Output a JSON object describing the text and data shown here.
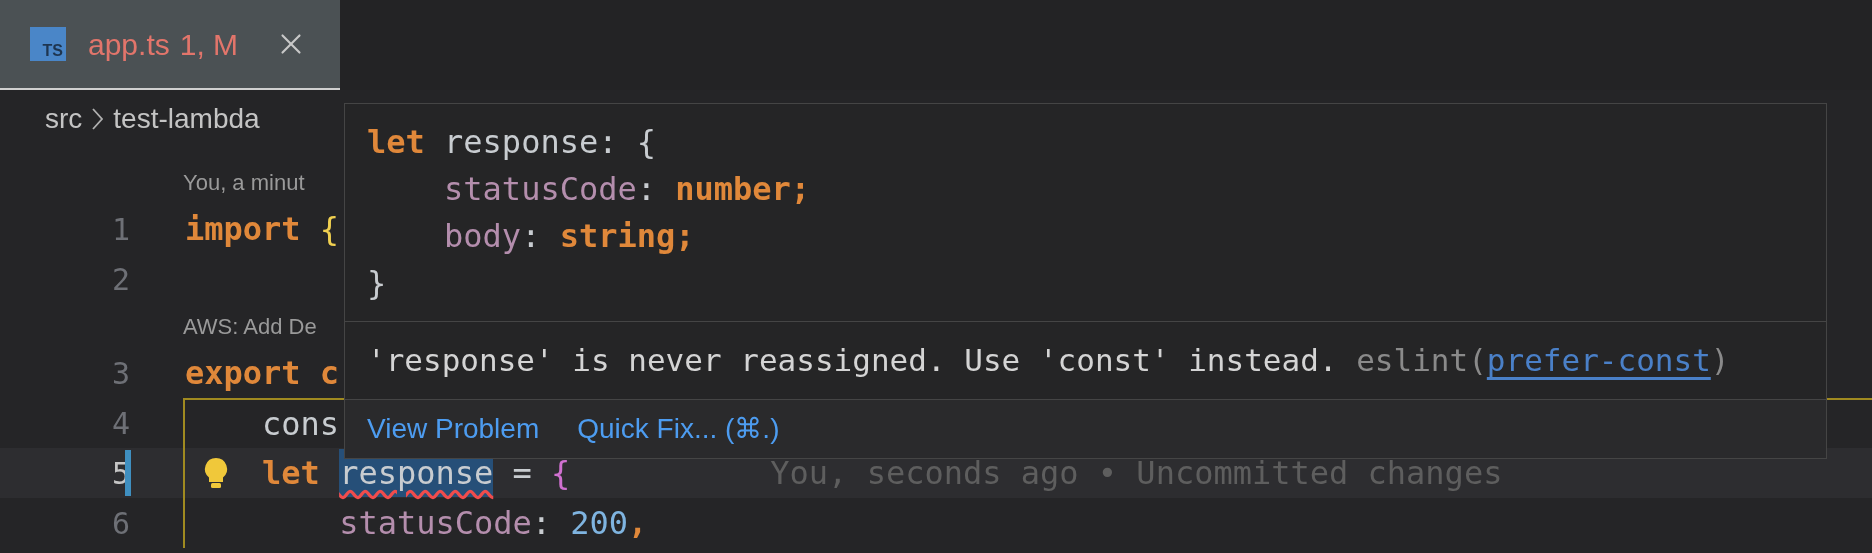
{
  "tab": {
    "icon": "TS",
    "label": "app.ts",
    "badge": "1, M"
  },
  "breadcrumb": [
    "src",
    "test-lambda"
  ],
  "editor": {
    "lines": [
      {
        "kind": "codelens",
        "text": "You, a minut"
      },
      {
        "kind": "code",
        "number": "1",
        "modified": false,
        "lightbulb": false,
        "current": false,
        "bracket_scope": false,
        "tokens": [
          {
            "text": "import",
            "kind": "keyword"
          },
          {
            "text": " {",
            "kind": "brace"
          }
        ]
      },
      {
        "kind": "code",
        "number": "2",
        "modified": false,
        "lightbulb": false,
        "current": false,
        "bracket_scope": false
      },
      {
        "kind": "codelens",
        "text": "AWS: Add De"
      },
      {
        "kind": "code",
        "number": "3",
        "modified": false,
        "lightbulb": false,
        "current": false,
        "bracket_scope": false,
        "tokens": [
          {
            "text": "export c",
            "kind": "keyword"
          }
        ]
      },
      {
        "kind": "code",
        "number": "4",
        "modified": false,
        "lightbulb": false,
        "current": false,
        "bracket_scope": true,
        "tokens": [
          {
            "text": "    cons",
            "kind": "plain"
          }
        ]
      },
      {
        "kind": "code",
        "number": "5",
        "modified": true,
        "lightbulb": true,
        "current": true,
        "bracket_scope": true,
        "tokens": [
          {
            "text": "let ",
            "kind": "keyword"
          },
          {
            "text": "response",
            "kind": "error"
          },
          {
            "text": " = ",
            "kind": "plain"
          },
          {
            "text": "{",
            "kind": "brace2"
          }
        ],
        "blame": "You, seconds ago • Uncommitted changes"
      },
      {
        "kind": "code",
        "number": "6",
        "modified": false,
        "lightbulb": false,
        "current": false,
        "bracket_scope": true,
        "tokens": [
          {
            "text": "        statusCode",
            "kind": "property"
          },
          {
            "text": ": ",
            "kind": "plain"
          },
          {
            "text": "200",
            "kind": "number"
          },
          {
            "text": ",",
            "kind": "keyword"
          }
        ]
      }
    ]
  },
  "hover": {
    "code": [
      [
        {
          "text": "let",
          "kind": "keyword"
        },
        {
          "text": " response: {",
          "kind": "plain"
        }
      ],
      [
        {
          "text": "    statusCode",
          "kind": "property"
        },
        {
          "text": ": ",
          "kind": "plain"
        },
        {
          "text": "number;",
          "kind": "keyword"
        }
      ],
      [
        {
          "text": "    body",
          "kind": "property"
        },
        {
          "text": ": ",
          "kind": "plain"
        },
        {
          "text": "string;",
          "kind": "keyword"
        }
      ],
      [
        {
          "text": "}",
          "kind": "plain"
        }
      ]
    ],
    "message": "'response' is never reassigned. Use 'const' instead.",
    "source": "eslint(",
    "rule": "prefer-const",
    "source_end": ")",
    "actions": [
      "View Problem",
      "Quick Fix... (⌘.)"
    ]
  }
}
